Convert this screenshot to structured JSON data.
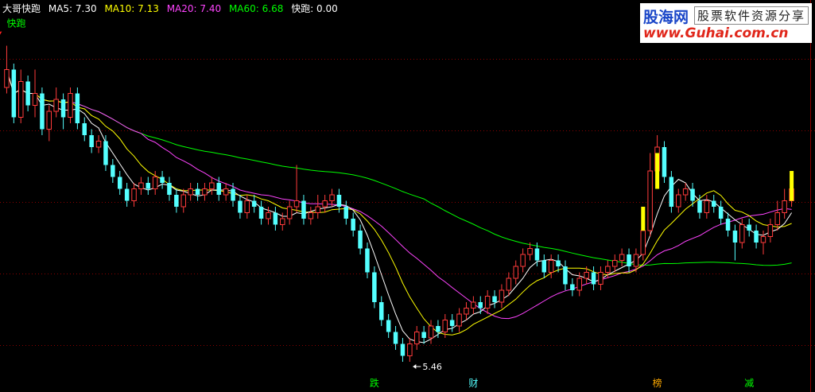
{
  "legend": {
    "title": "大哥快跑",
    "items": [
      {
        "label": "MA5: 7.30",
        "color": "#ffffff"
      },
      {
        "label": "MA10: 7.13",
        "color": "#ffff00"
      },
      {
        "label": "MA20: 7.40",
        "color": "#ff44ff"
      },
      {
        "label": "MA60: 6.68",
        "color": "#00ff00"
      },
      {
        "label": "快跑: 0.00",
        "color": "#ffffff"
      }
    ]
  },
  "logo": {
    "name": "股海网",
    "tagline": "股票软件资源分享",
    "url": "www.Guhai.com.cn"
  },
  "annotation": {
    "text": "快跑",
    "color": "#00ff00"
  },
  "low_label": "5.46",
  "chart_data": {
    "type": "candlestick",
    "colors": {
      "up": "#ff3b3b",
      "down": "#54ffff",
      "ma5": "#ffffff",
      "ma10": "#ffff00",
      "ma20": "#ff44ff",
      "ma60": "#00ff00",
      "signal": "#ffff00",
      "grid": "#8a0000"
    },
    "candles": [
      [
        8.6,
        8.9,
        9.3,
        8.5
      ],
      [
        8.9,
        8.1,
        9.0,
        8.0
      ],
      [
        8.1,
        8.7,
        8.9,
        8.0
      ],
      [
        8.7,
        8.3,
        8.8,
        8.2
      ],
      [
        8.3,
        8.5,
        8.9,
        8.1
      ],
      [
        8.5,
        7.9,
        8.6,
        7.8
      ],
      [
        7.9,
        8.2,
        8.3,
        7.7
      ],
      [
        8.2,
        8.4,
        8.6,
        8.1
      ],
      [
        8.4,
        8.1,
        8.5,
        7.9
      ],
      [
        8.1,
        8.5,
        8.6,
        8.0
      ],
      [
        8.5,
        8.0,
        8.6,
        7.9
      ],
      [
        8.0,
        7.8,
        8.1,
        7.7
      ],
      [
        7.8,
        7.6,
        7.9,
        7.5
      ],
      [
        7.6,
        7.7,
        7.8,
        7.5
      ],
      [
        7.7,
        7.3,
        7.8,
        7.2
      ],
      [
        7.3,
        7.1,
        7.4,
        7.0
      ],
      [
        7.1,
        6.9,
        7.2,
        6.8
      ],
      [
        6.9,
        6.7,
        7.0,
        6.6
      ],
      [
        6.7,
        6.9,
        7.0,
        6.6
      ],
      [
        6.9,
        7.0,
        7.1,
        6.8
      ],
      [
        7.0,
        6.9,
        7.1,
        6.8
      ],
      [
        6.9,
        7.1,
        7.2,
        6.8
      ],
      [
        7.1,
        7.0,
        7.2,
        6.9
      ],
      [
        7.0,
        6.8,
        7.1,
        6.7
      ],
      [
        6.8,
        6.6,
        6.9,
        6.5
      ],
      [
        6.6,
        6.8,
        6.9,
        6.5
      ],
      [
        6.8,
        6.9,
        7.0,
        6.7
      ],
      [
        6.9,
        6.8,
        7.0,
        6.7
      ],
      [
        6.8,
        6.9,
        7.0,
        6.7
      ],
      [
        6.9,
        7.0,
        7.1,
        6.8
      ],
      [
        7.0,
        6.8,
        7.1,
        6.7
      ],
      [
        6.8,
        6.9,
        7.0,
        6.7
      ],
      [
        6.9,
        6.7,
        7.0,
        6.6
      ],
      [
        6.7,
        6.5,
        6.8,
        6.4
      ],
      [
        6.5,
        6.7,
        6.8,
        6.4
      ],
      [
        6.7,
        6.6,
        6.8,
        6.5
      ],
      [
        6.6,
        6.4,
        6.7,
        6.3
      ],
      [
        6.4,
        6.5,
        6.6,
        6.3
      ],
      [
        6.5,
        6.3,
        6.6,
        6.2
      ],
      [
        6.3,
        6.4,
        6.5,
        6.2
      ],
      [
        6.4,
        6.6,
        6.7,
        6.3
      ],
      [
        6.6,
        6.7,
        7.3,
        6.5
      ],
      [
        6.7,
        6.4,
        6.8,
        6.3
      ],
      [
        6.4,
        6.5,
        6.6,
        6.3
      ],
      [
        6.5,
        6.6,
        6.8,
        6.4
      ],
      [
        6.6,
        6.7,
        6.8,
        6.5
      ],
      [
        6.7,
        6.8,
        6.9,
        6.6
      ],
      [
        6.8,
        6.6,
        6.9,
        6.5
      ],
      [
        6.6,
        6.4,
        6.7,
        6.3
      ],
      [
        6.4,
        6.2,
        6.5,
        6.1
      ],
      [
        6.2,
        5.9,
        6.3,
        5.8
      ],
      [
        5.9,
        5.5,
        6.0,
        5.4
      ],
      [
        5.5,
        5.0,
        5.6,
        4.9
      ],
      [
        5.0,
        4.7,
        5.1,
        4.6
      ],
      [
        4.7,
        4.5,
        4.8,
        4.4
      ],
      [
        4.5,
        4.3,
        4.6,
        4.2
      ],
      [
        4.3,
        4.1,
        4.4,
        4.0
      ],
      [
        4.1,
        4.3,
        4.4,
        4.0
      ],
      [
        4.3,
        4.5,
        4.6,
        4.2
      ],
      [
        4.5,
        4.4,
        4.6,
        4.3
      ],
      [
        4.4,
        4.6,
        4.7,
        4.3
      ],
      [
        4.6,
        4.5,
        4.7,
        4.4
      ],
      [
        4.5,
        4.7,
        4.8,
        4.4
      ],
      [
        4.7,
        4.6,
        4.8,
        4.5
      ],
      [
        4.6,
        4.8,
        4.9,
        4.5
      ],
      [
        4.8,
        4.9,
        5.0,
        4.7
      ],
      [
        4.9,
        5.0,
        5.1,
        4.8
      ],
      [
        5.0,
        4.9,
        5.1,
        4.8
      ],
      [
        4.9,
        5.1,
        5.2,
        4.8
      ],
      [
        5.1,
        5.0,
        5.2,
        4.9
      ],
      [
        5.0,
        5.2,
        5.3,
        4.9
      ],
      [
        5.2,
        5.4,
        5.5,
        5.1
      ],
      [
        5.4,
        5.6,
        5.7,
        5.3
      ],
      [
        5.6,
        5.8,
        5.9,
        5.5
      ],
      [
        5.8,
        5.9,
        6.0,
        5.7
      ],
      [
        5.9,
        5.7,
        6.0,
        5.6
      ],
      [
        5.7,
        5.5,
        5.8,
        5.4
      ],
      [
        5.5,
        5.7,
        5.8,
        5.4
      ],
      [
        5.7,
        5.6,
        5.8,
        5.5
      ],
      [
        5.6,
        5.3,
        5.7,
        5.2
      ],
      [
        5.3,
        5.2,
        5.4,
        5.1
      ],
      [
        5.2,
        5.4,
        5.5,
        5.1
      ],
      [
        5.4,
        5.5,
        5.6,
        5.3
      ],
      [
        5.5,
        5.3,
        5.6,
        5.2
      ],
      [
        5.3,
        5.5,
        5.6,
        5.2
      ],
      [
        5.5,
        5.6,
        5.7,
        5.4
      ],
      [
        5.6,
        5.7,
        5.8,
        5.5
      ],
      [
        5.7,
        5.8,
        5.9,
        5.6
      ],
      [
        5.8,
        5.6,
        5.9,
        5.5
      ],
      [
        5.6,
        5.8,
        5.9,
        5.5
      ],
      [
        5.8,
        6.2,
        6.4,
        5.7
      ],
      [
        6.2,
        7.2,
        7.5,
        6.1
      ],
      [
        7.2,
        7.6,
        7.8,
        7.1
      ],
      [
        7.6,
        7.1,
        7.7,
        7.0
      ],
      [
        7.1,
        6.6,
        7.2,
        6.5
      ],
      [
        6.6,
        6.8,
        6.9,
        6.5
      ],
      [
        6.8,
        6.9,
        7.0,
        6.7
      ],
      [
        6.9,
        6.7,
        7.0,
        6.6
      ],
      [
        6.7,
        6.5,
        6.8,
        6.4
      ],
      [
        6.5,
        6.7,
        6.8,
        6.4
      ],
      [
        6.7,
        6.6,
        6.8,
        6.5
      ],
      [
        6.6,
        6.4,
        6.7,
        6.3
      ],
      [
        6.4,
        6.2,
        6.5,
        6.1
      ],
      [
        6.2,
        6.0,
        6.3,
        5.7
      ],
      [
        6.0,
        6.3,
        6.4,
        5.9
      ],
      [
        6.3,
        6.2,
        6.4,
        6.1
      ],
      [
        6.2,
        6.0,
        6.3,
        5.9
      ],
      [
        6.0,
        6.1,
        6.2,
        5.8
      ],
      [
        6.1,
        6.3,
        6.4,
        6.0
      ],
      [
        6.3,
        6.5,
        6.7,
        6.2
      ],
      [
        6.5,
        6.7,
        6.9,
        6.4
      ],
      [
        6.7,
        6.9,
        7.0,
        6.6
      ]
    ],
    "signals": [
      {
        "index": 92,
        "low": 6.9,
        "high": 7.5
      },
      {
        "index": 90,
        "low": 6.2,
        "high": 6.6
      },
      {
        "index": 111,
        "low": 6.7,
        "high": 7.2
      }
    ],
    "bottom_labels": [
      {
        "index": 52,
        "text": "跌",
        "color": "#00ff00"
      },
      {
        "index": 66,
        "text": "财",
        "color": "#54ffff"
      },
      {
        "index": 92,
        "text": "榜",
        "color": "#ffaa00"
      },
      {
        "index": 105,
        "text": "减",
        "color": "#00ff00"
      }
    ],
    "low_index": 57
  }
}
